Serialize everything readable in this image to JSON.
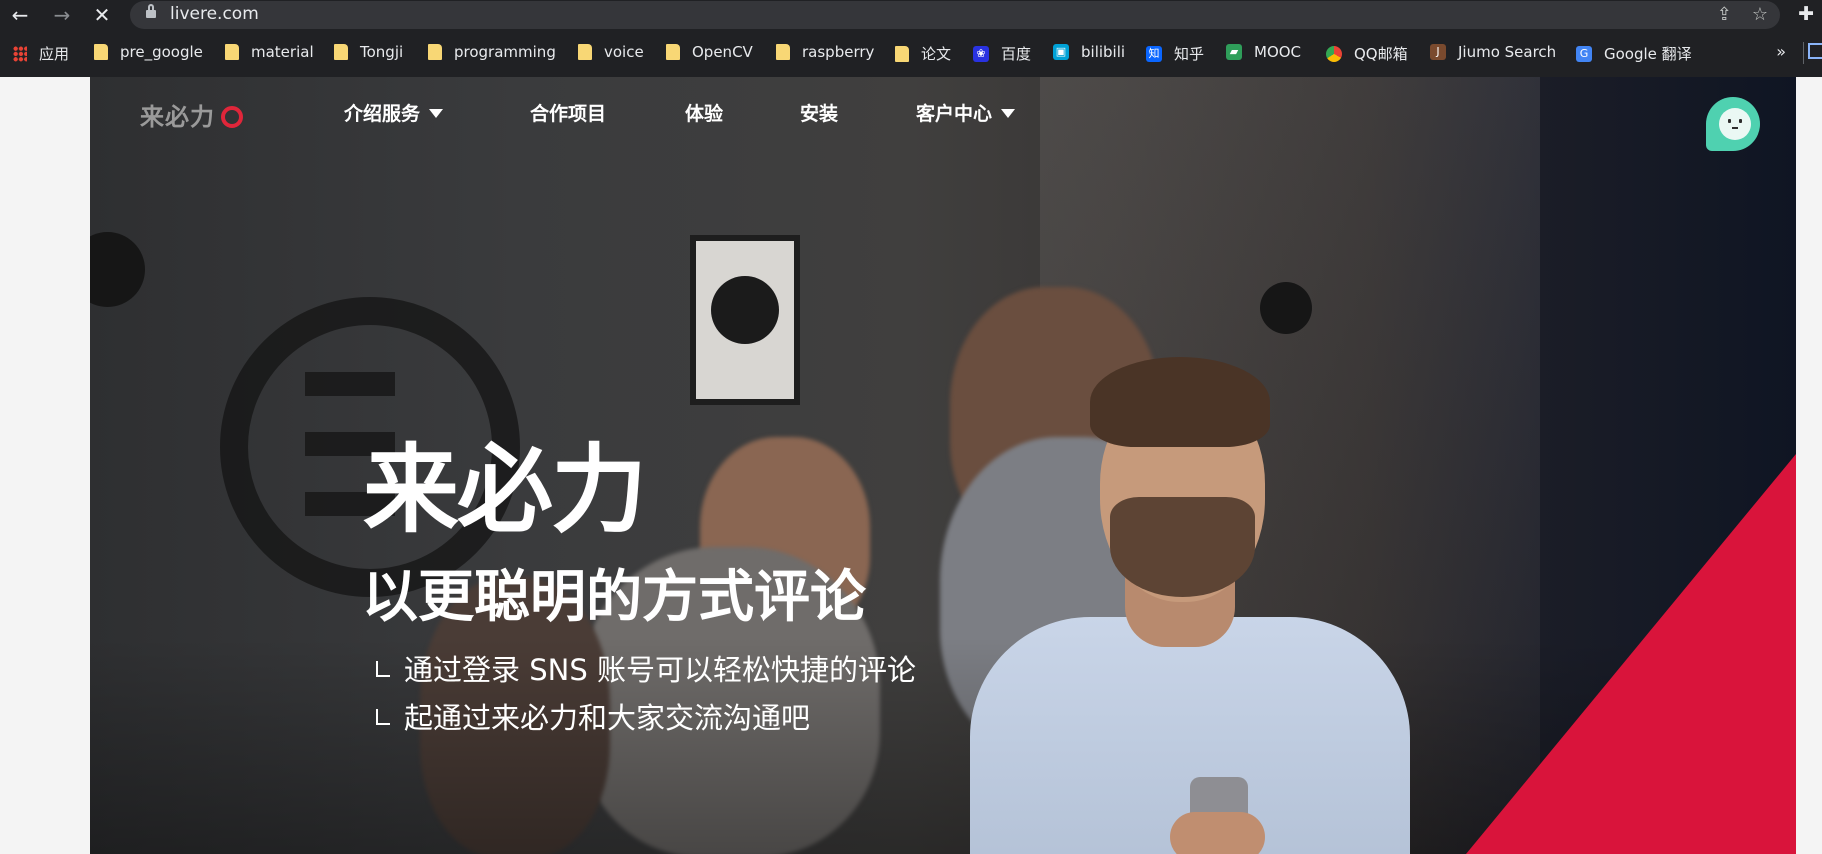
{
  "browser": {
    "url": "livere.com",
    "bookmarks": [
      {
        "label": "应用",
        "icon": "apps-grid-icon"
      },
      {
        "label": "pre_google",
        "icon": "folder-icon"
      },
      {
        "label": "material",
        "icon": "folder-icon"
      },
      {
        "label": "Tongji",
        "icon": "folder-icon"
      },
      {
        "label": "programming",
        "icon": "folder-icon"
      },
      {
        "label": "voice",
        "icon": "folder-icon"
      },
      {
        "label": "OpenCV",
        "icon": "folder-icon"
      },
      {
        "label": "raspberry",
        "icon": "folder-icon"
      },
      {
        "label": "论文",
        "icon": "folder-icon"
      },
      {
        "label": "百度",
        "icon": "baidu-icon"
      },
      {
        "label": "bilibili",
        "icon": "bilibili-icon"
      },
      {
        "label": "知乎",
        "icon": "zhihu-icon"
      },
      {
        "label": "MOOC",
        "icon": "mooc-icon"
      },
      {
        "label": "QQ邮箱",
        "icon": "chrome-icon"
      },
      {
        "label": "Jiumo Search",
        "icon": "jiumo-icon"
      },
      {
        "label": "Google 翻译",
        "icon": "google-translate-icon"
      }
    ],
    "more": "»"
  },
  "site": {
    "logo": "来必力",
    "nav": [
      {
        "label": "介绍服务",
        "dropdown": true
      },
      {
        "label": "合作项目",
        "dropdown": false
      },
      {
        "label": "体验",
        "dropdown": false
      },
      {
        "label": "安装",
        "dropdown": false
      },
      {
        "label": "客户中心",
        "dropdown": true
      }
    ],
    "hero": {
      "title": "来必力",
      "subtitle": "以更聪明的方式评论",
      "lines": [
        "通过登录 SNS 账号可以轻松快捷的评论",
        "起通过来必力和大家交流沟通吧"
      ]
    }
  },
  "colors": {
    "brand_red": "#e0263a",
    "accent_teal": "#4fd1b0",
    "chrome_dark": "#202124"
  }
}
